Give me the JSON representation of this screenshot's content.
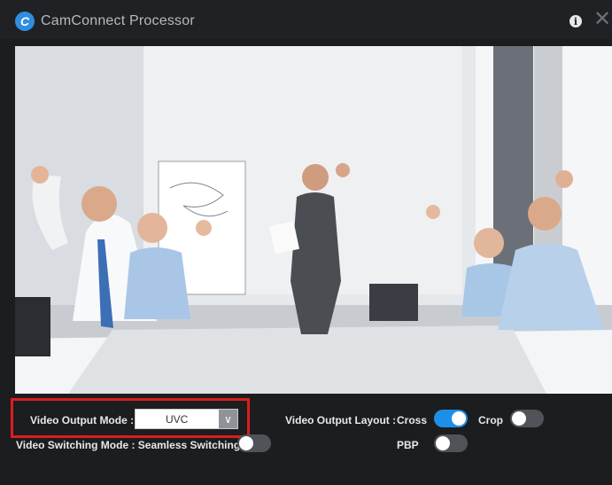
{
  "window": {
    "title": "CamConnect Processor",
    "logo_letter": "C"
  },
  "icons": {
    "logo": "app-logo-icon",
    "info": "info-icon",
    "close": "close-icon"
  },
  "controls": {
    "video_output_mode_label": "Video Output Mode :",
    "video_output_mode_value": "UVC",
    "video_switching_mode_label": "Video Switching Mode : Seamless Switching",
    "video_switching_mode_enabled": false,
    "video_output_layout_label": "Video Output Layout :",
    "layout_options": [
      {
        "label": "Cross",
        "enabled": true
      },
      {
        "label": "Crop",
        "enabled": false
      },
      {
        "label": "PBP",
        "enabled": false
      }
    ]
  },
  "colors": {
    "accent": "#1e8fe6",
    "highlight": "#d91e1e",
    "background": "#1c1d1f"
  }
}
